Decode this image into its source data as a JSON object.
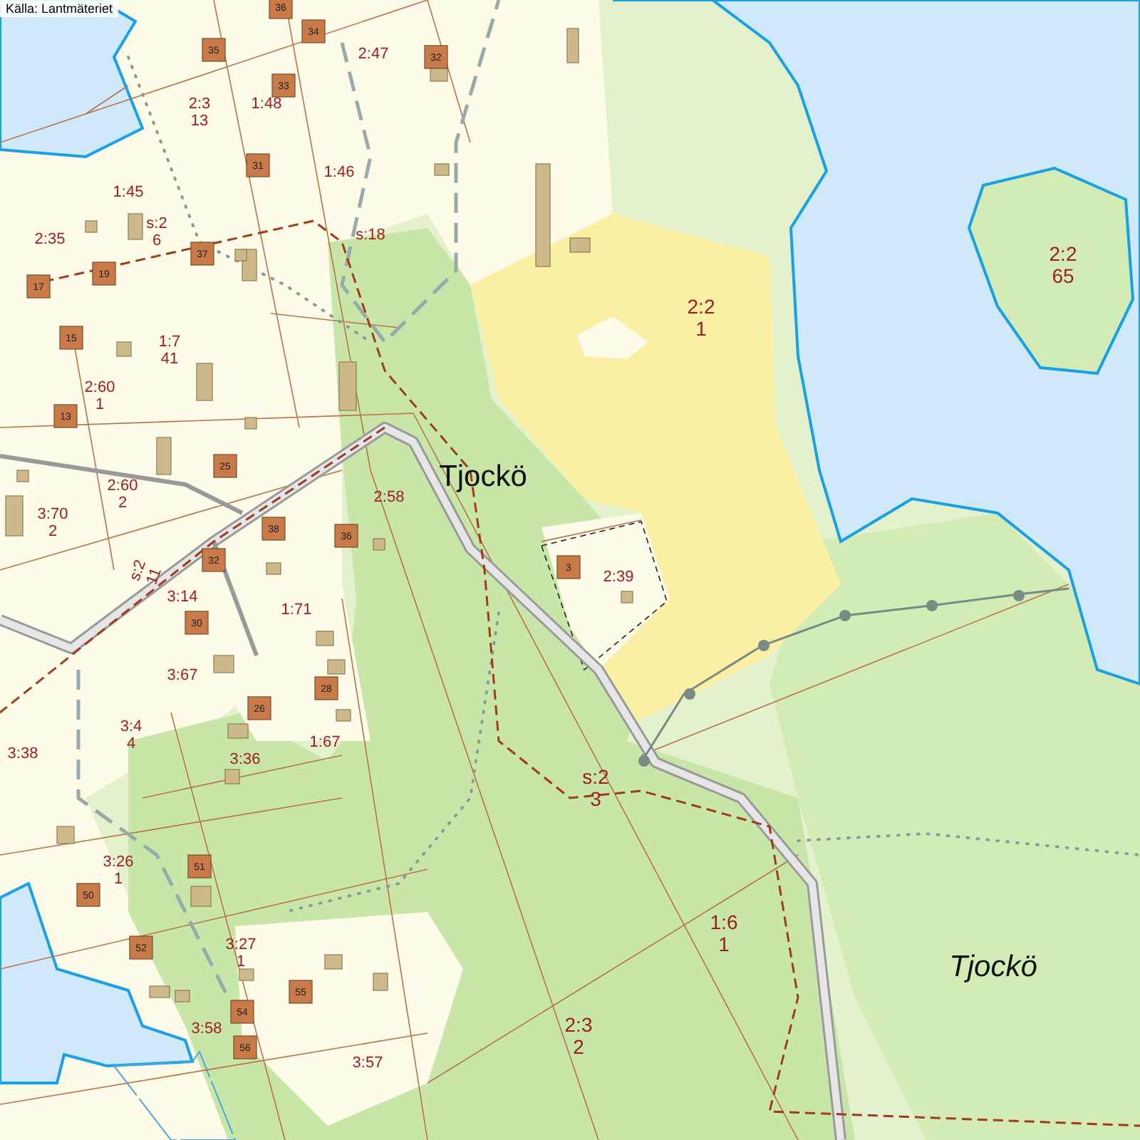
{
  "attribution": "Källa: Lantmäteriet",
  "place_names": [
    {
      "text": "Tjockö",
      "kind": "upright"
    },
    {
      "text": "Tjockö",
      "kind": "italic"
    }
  ],
  "parcel_labels": [
    {
      "lines": [
        "2:47"
      ]
    },
    {
      "lines": [
        "2:3",
        "13"
      ]
    },
    {
      "lines": [
        "1:48"
      ]
    },
    {
      "lines": [
        "1:45"
      ]
    },
    {
      "lines": [
        "1:46"
      ]
    },
    {
      "lines": [
        "2:35"
      ]
    },
    {
      "lines": [
        "s:2",
        "6"
      ]
    },
    {
      "lines": [
        "s:18"
      ]
    },
    {
      "lines": [
        "2:2",
        "1"
      ]
    },
    {
      "lines": [
        "2:2",
        "65"
      ]
    },
    {
      "lines": [
        "1:7",
        "41"
      ]
    },
    {
      "lines": [
        "2:60",
        "1"
      ]
    },
    {
      "lines": [
        "2:60",
        "2"
      ]
    },
    {
      "lines": [
        "3:70",
        "2"
      ]
    },
    {
      "lines": [
        "2:58"
      ]
    },
    {
      "lines": [
        "2:39"
      ]
    },
    {
      "lines": [
        "s:2",
        "11"
      ]
    },
    {
      "lines": [
        "3:14"
      ]
    },
    {
      "lines": [
        "1:71"
      ]
    },
    {
      "lines": [
        "3:67"
      ]
    },
    {
      "lines": [
        "3:4",
        "4"
      ]
    },
    {
      "lines": [
        "3:38"
      ]
    },
    {
      "lines": [
        "3:36"
      ]
    },
    {
      "lines": [
        "1:67"
      ]
    },
    {
      "lines": [
        "s:2",
        "3"
      ]
    },
    {
      "lines": [
        "3:26",
        "1"
      ]
    },
    {
      "lines": [
        "3:27",
        "1"
      ]
    },
    {
      "lines": [
        "1:6",
        "1"
      ]
    },
    {
      "lines": [
        "3:58"
      ]
    },
    {
      "lines": [
        "2:3",
        "2"
      ]
    },
    {
      "lines": [
        "3:57"
      ]
    }
  ],
  "house_numbers": [
    "36",
    "34",
    "35",
    "32",
    "33",
    "31",
    "37",
    "19",
    "17",
    "15",
    "13",
    "25",
    "38",
    "36",
    "32",
    "30",
    "3",
    "28",
    "26",
    "51",
    "50",
    "52",
    "55",
    "54",
    "56"
  ]
}
